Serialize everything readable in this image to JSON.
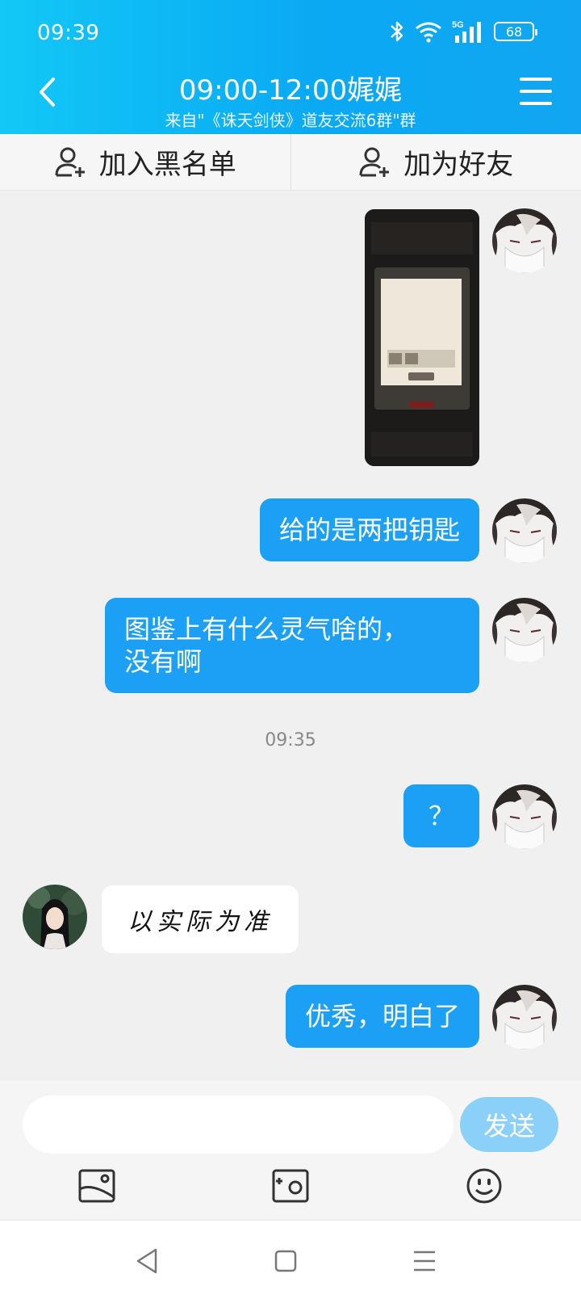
{
  "status_bar": {
    "time": "09:39",
    "battery": "68",
    "network": "5G"
  },
  "header": {
    "title": "09:00-12:00娓娓",
    "subtitle": "来自\"《诛天剑侠》道友交流6群\"群"
  },
  "actions": [
    {
      "label": "加入黑名单"
    },
    {
      "label": "加为好友"
    }
  ],
  "messages": [
    {
      "type": "image",
      "side": "right"
    },
    {
      "type": "text",
      "side": "right",
      "text": "给的是两把钥匙"
    },
    {
      "type": "text",
      "side": "right",
      "text": "图鉴上有什么灵气啥的，\n没有啊"
    },
    {
      "type": "timestamp",
      "text": "09:35"
    },
    {
      "type": "text",
      "side": "right",
      "text": "？"
    },
    {
      "type": "text",
      "side": "left",
      "text": "以实际为准"
    },
    {
      "type": "text",
      "side": "right",
      "text": "优秀，明白了"
    }
  ],
  "composer": {
    "input_value": "",
    "placeholder": "",
    "send_label": "发送"
  },
  "colors": {
    "header": "#0aa9f3",
    "bubble_out": "#1ca0f5",
    "send": "#8bd0f8",
    "background": "#f0f0f0"
  }
}
